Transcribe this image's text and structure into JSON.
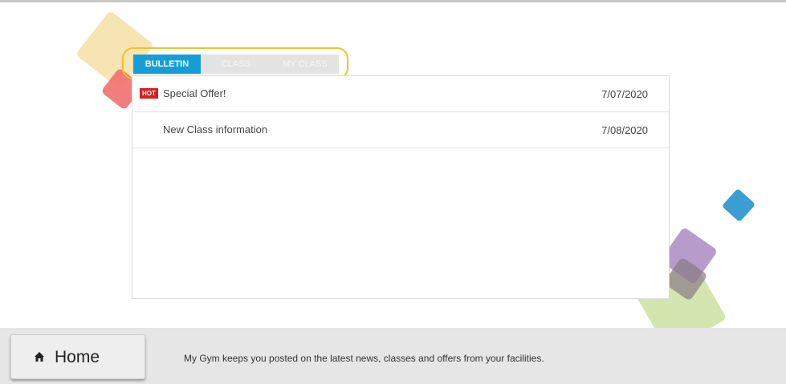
{
  "tabs": {
    "bulletin": "BULLETIN",
    "class": "CLASS",
    "my_class": "MY CLASS"
  },
  "bulletins": [
    {
      "badge": "HOT",
      "title": "Special Offer!",
      "date": "7/07/2020"
    },
    {
      "badge": "",
      "title": "New Class information",
      "date": "7/08/2020"
    }
  ],
  "footer": {
    "home_label": "Home",
    "home_icon": "home-icon",
    "message": "My Gym keeps you posted on the latest news, classes and offers from your facilities."
  },
  "colors": {
    "tab_active": "#159ed6",
    "hot_badge": "#d71f1f",
    "highlight_ring": "#f2c02a"
  }
}
